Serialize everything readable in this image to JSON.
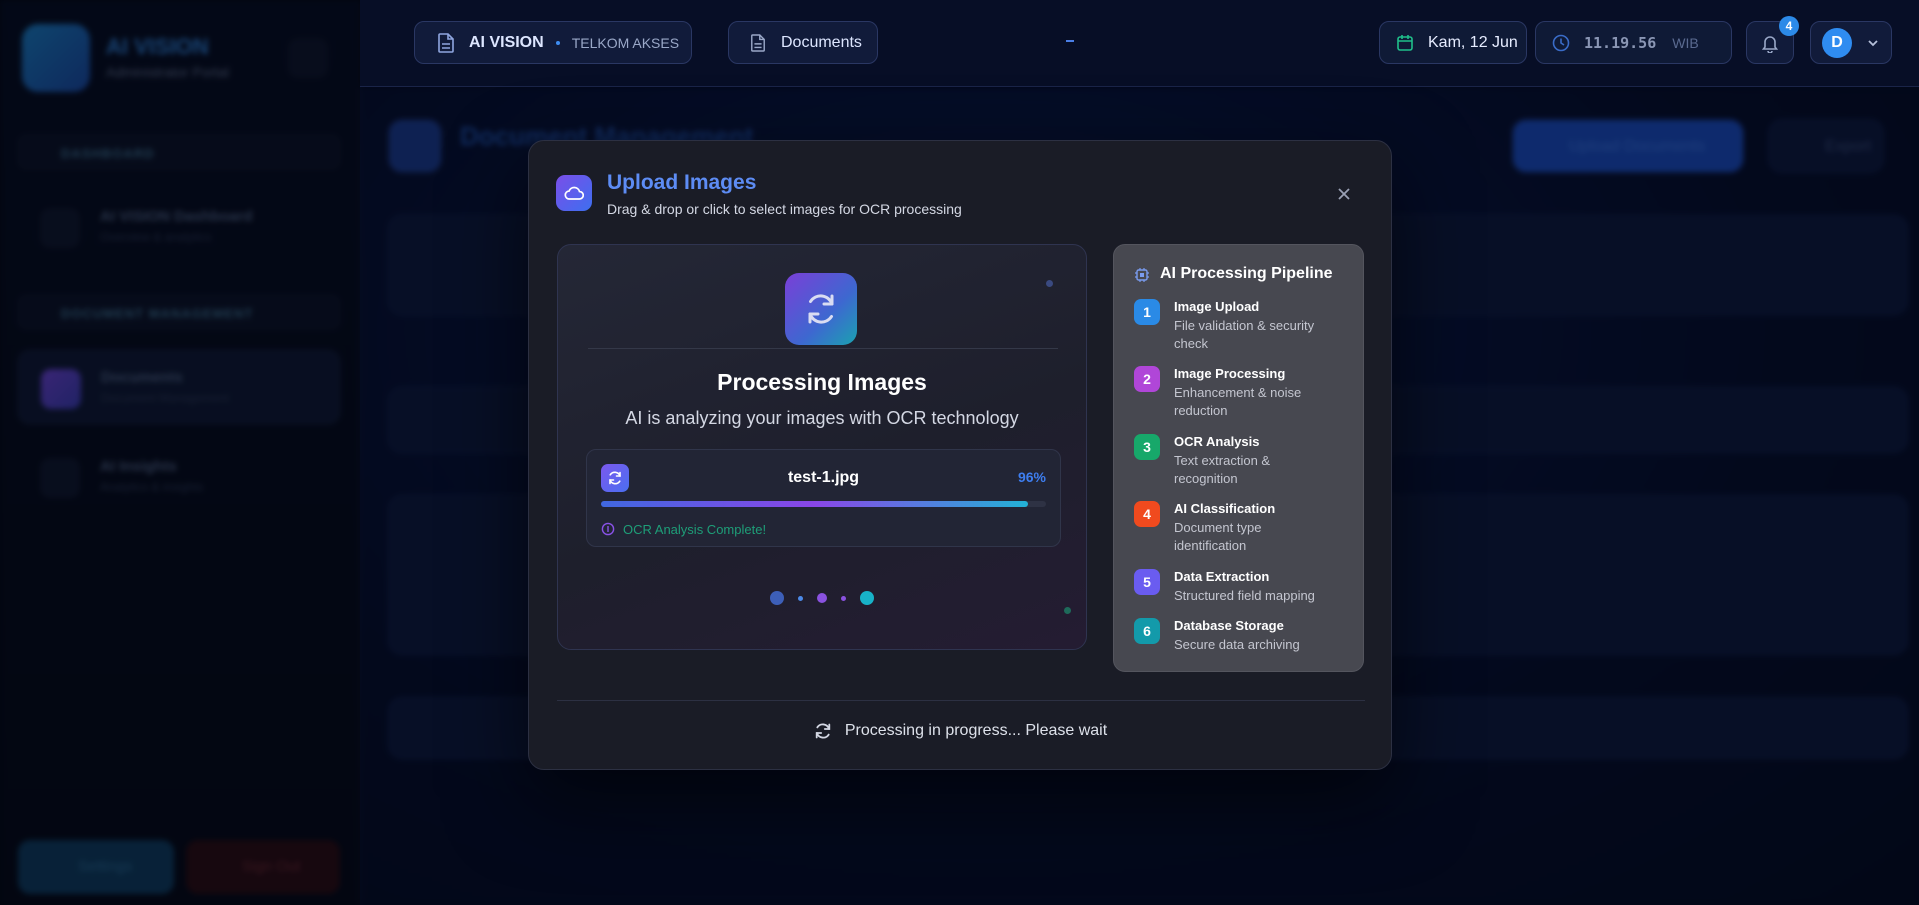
{
  "sidebar": {
    "app_title": "AI VISION",
    "app_subtitle": "Administrator Portal",
    "section_dashboard": "DASHBOARD",
    "item_dashboard_title": "AI VISION Dashboard",
    "item_dashboard_sub": "Overview & analytics",
    "section_docs": "DOCUMENT MANAGEMENT",
    "item_docs_title": "Documents",
    "item_docs_sub": "Document Management",
    "item_insights_title": "AI Insights",
    "item_insights_sub": "Analytics & insights",
    "settings_label": "Settings",
    "signout_label": "Sign Out"
  },
  "topbar": {
    "brand_name": "AI VISION",
    "brand_sub": "TELKOM AKSES",
    "breadcrumb": "Documents",
    "date": "Kam, 12 Jun",
    "time": "11.19.56",
    "timezone": "WIB",
    "notifications": "4",
    "avatar_initial": "D"
  },
  "background": {
    "page_title": "Document Management",
    "upload_button": "Upload Documents",
    "export_button": "Export"
  },
  "modal": {
    "title": "Upload Images",
    "subtitle": "Drag & drop or click to select images for OCR processing",
    "processing_title": "Processing Images",
    "processing_subtitle": "AI is analyzing your images with OCR technology",
    "file": {
      "name": "test-1.jpg",
      "percent": "96%",
      "progress": 0.96,
      "status": "OCR Analysis Complete!"
    },
    "pipeline": {
      "title": "AI Processing Pipeline",
      "steps": [
        {
          "num": "1",
          "title": "Image Upload",
          "desc": "File validation & security check",
          "color": "#2a8ae6"
        },
        {
          "num": "2",
          "title": "Image Processing",
          "desc": "Enhancement & noise reduction",
          "color": "#b046d8"
        },
        {
          "num": "3",
          "title": "OCR Analysis",
          "desc": "Text extraction & recognition",
          "color": "#17a86a"
        },
        {
          "num": "4",
          "title": "AI Classification",
          "desc": "Document type identification",
          "color": "#f04a1e"
        },
        {
          "num": "5",
          "title": "Data Extraction",
          "desc": "Structured field mapping",
          "color": "#6a5cf0"
        },
        {
          "num": "6",
          "title": "Database Storage",
          "desc": "Secure data archiving",
          "color": "#139aaa"
        }
      ]
    },
    "footer_text": "Processing in progress... Please wait"
  },
  "colors": {
    "accent": "#3e7ef0",
    "success": "#1e9e78"
  }
}
